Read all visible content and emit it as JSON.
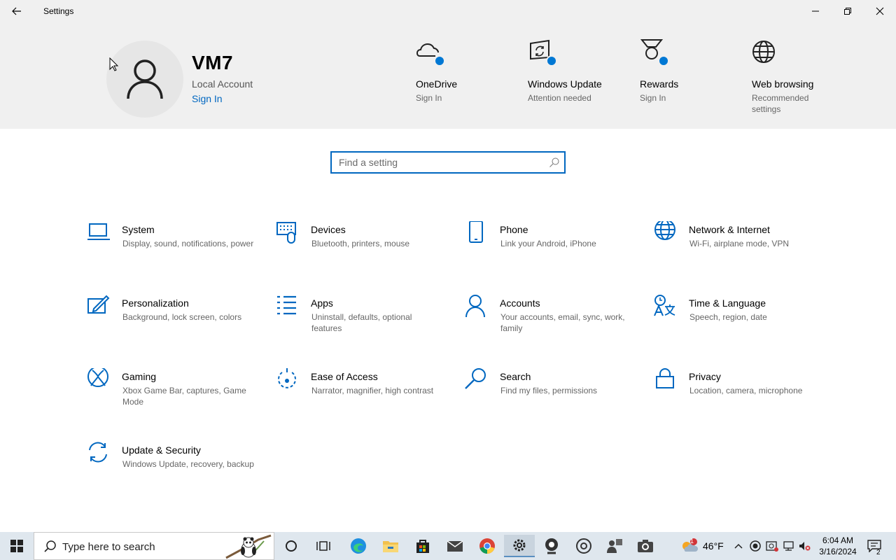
{
  "window": {
    "title": "Settings"
  },
  "account": {
    "name": "VM7",
    "type": "Local Account",
    "sign_in": "Sign In"
  },
  "header_items": [
    {
      "label": "OneDrive",
      "sub": "Sign In",
      "icon": "onedrive-icon"
    },
    {
      "label": "Windows Update",
      "sub": "Attention needed",
      "icon": "windows-update-icon"
    },
    {
      "label": "Rewards",
      "sub": "Sign In",
      "icon": "rewards-icon"
    },
    {
      "label": "Web browsing",
      "sub": "Recommended settings",
      "icon": "globe-icon"
    }
  ],
  "search": {
    "placeholder": "Find a setting"
  },
  "tiles": [
    {
      "title": "System",
      "desc": "Display, sound, notifications, power",
      "icon": "laptop-icon"
    },
    {
      "title": "Devices",
      "desc": "Bluetooth, printers, mouse",
      "icon": "devices-icon"
    },
    {
      "title": "Phone",
      "desc": "Link your Android, iPhone",
      "icon": "phone-icon"
    },
    {
      "title": "Network & Internet",
      "desc": "Wi-Fi, airplane mode, VPN",
      "icon": "globe-icon"
    },
    {
      "title": "Personalization",
      "desc": "Background, lock screen, colors",
      "icon": "personalization-icon"
    },
    {
      "title": "Apps",
      "desc": "Uninstall, defaults, optional features",
      "icon": "apps-list-icon"
    },
    {
      "title": "Accounts",
      "desc": "Your accounts, email, sync, work, family",
      "icon": "person-icon"
    },
    {
      "title": "Time & Language",
      "desc": "Speech, region, date",
      "icon": "time-language-icon"
    },
    {
      "title": "Gaming",
      "desc": "Xbox Game Bar, captures, Game Mode",
      "icon": "xbox-icon"
    },
    {
      "title": "Ease of Access",
      "desc": "Narrator, magnifier, high contrast",
      "icon": "ease-of-access-icon"
    },
    {
      "title": "Search",
      "desc": "Find my files, permissions",
      "icon": "search-icon"
    },
    {
      "title": "Privacy",
      "desc": "Location, camera, microphone",
      "icon": "lock-icon"
    },
    {
      "title": "Update & Security",
      "desc": "Windows Update, recovery, backup",
      "icon": "refresh-icon"
    }
  ],
  "taskbar": {
    "search_text": "Type here to search",
    "temperature": "46°F",
    "time": "6:04 AM",
    "date": "3/16/2024",
    "weather_badge": "1",
    "notifications": "2"
  },
  "colors": {
    "accent": "#0067c0",
    "header_bg": "#f0f0f0",
    "dot_blue": "#0078d4"
  }
}
